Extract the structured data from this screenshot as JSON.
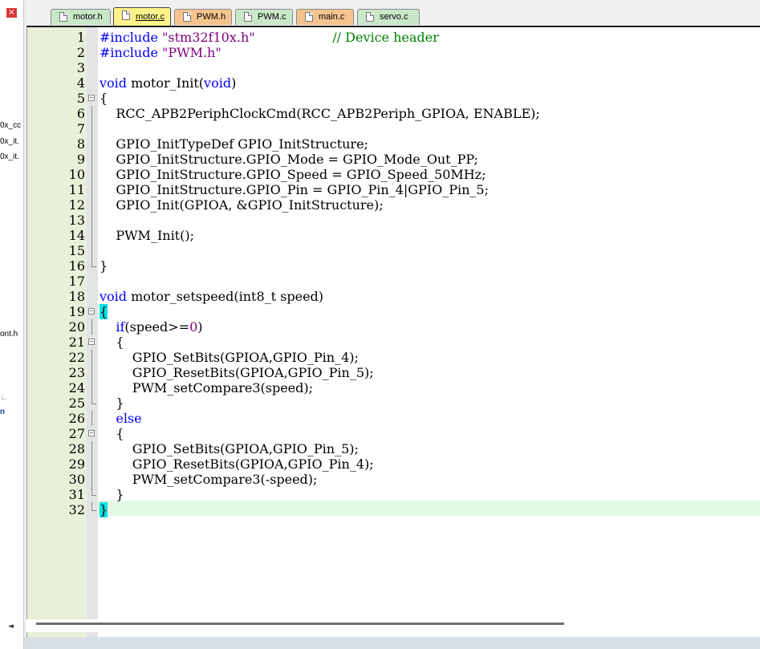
{
  "left_panel": {
    "close_glyph": "×",
    "truncated_items": [
      "0x_cc",
      "0x_it.",
      "0x_it.",
      "ont.h",
      "∟",
      "n"
    ],
    "scroll_arrow": "◄"
  },
  "tabs": [
    {
      "label": "motor.h",
      "active": false,
      "color": "#c9e7c9"
    },
    {
      "label": "motor.c",
      "active": true,
      "color": "#fff28a"
    },
    {
      "label": "PWM.h",
      "active": false,
      "color": "#f5c48e"
    },
    {
      "label": "PWM.c",
      "active": false,
      "color": "#c9e7c9"
    },
    {
      "label": "main.c",
      "active": false,
      "color": "#f5c48e"
    },
    {
      "label": "servo.c",
      "active": false,
      "color": "#c9e7c9"
    }
  ],
  "editor": {
    "current_line": 32,
    "lines": [
      {
        "n": "1",
        "text": "#include \"stm32f10x.h\"                   // Device header"
      },
      {
        "n": "2",
        "text": "#include \"PWM.h\""
      },
      {
        "n": "3",
        "text": ""
      },
      {
        "n": "4",
        "text": "void motor_Init(void)"
      },
      {
        "n": "5",
        "text": "{"
      },
      {
        "n": "6",
        "text": "    RCC_APB2PeriphClockCmd(RCC_APB2Periph_GPIOA, ENABLE);"
      },
      {
        "n": "7",
        "text": ""
      },
      {
        "n": "8",
        "text": "    GPIO_InitTypeDef GPIO_InitStructure;"
      },
      {
        "n": "9",
        "text": "    GPIO_InitStructure.GPIO_Mode = GPIO_Mode_Out_PP;"
      },
      {
        "n": "10",
        "text": "    GPIO_InitStructure.GPIO_Speed = GPIO_Speed_50MHz;"
      },
      {
        "n": "11",
        "text": "    GPIO_InitStructure.GPIO_Pin = GPIO_Pin_4|GPIO_Pin_5;"
      },
      {
        "n": "12",
        "text": "    GPIO_Init(GPIOA, &GPIO_InitStructure);"
      },
      {
        "n": "13",
        "text": ""
      },
      {
        "n": "14",
        "text": "    PWM_Init();"
      },
      {
        "n": "15",
        "text": ""
      },
      {
        "n": "16",
        "text": "}"
      },
      {
        "n": "17",
        "text": ""
      },
      {
        "n": "18",
        "text": "void motor_setspeed(int8_t speed)"
      },
      {
        "n": "19",
        "text": "{"
      },
      {
        "n": "20",
        "text": "    if(speed>=0)"
      },
      {
        "n": "21",
        "text": "    {"
      },
      {
        "n": "22",
        "text": "        GPIO_SetBits(GPIOA,GPIO_Pin_4);"
      },
      {
        "n": "23",
        "text": "        GPIO_ResetBits(GPIOA,GPIO_Pin_5);"
      },
      {
        "n": "24",
        "text": "        PWM_setCompare3(speed);"
      },
      {
        "n": "25",
        "text": "    }"
      },
      {
        "n": "26",
        "text": "    else"
      },
      {
        "n": "27",
        "text": "    {"
      },
      {
        "n": "28",
        "text": "        GPIO_SetBits(GPIOA,GPIO_Pin_5);"
      },
      {
        "n": "29",
        "text": "        GPIO_ResetBits(GPIOA,GPIO_Pin_4);"
      },
      {
        "n": "30",
        "text": "        PWM_setCompare3(-speed);"
      },
      {
        "n": "31",
        "text": "    }"
      },
      {
        "n": "32",
        "text": "}"
      }
    ]
  }
}
